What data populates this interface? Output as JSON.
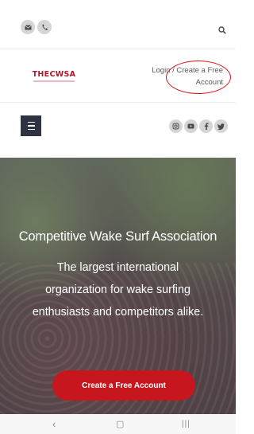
{
  "header": {
    "contact_icons": [
      "envelope-icon",
      "phone-icon"
    ],
    "search_icon": "search-icon"
  },
  "brand": {
    "logo_text": "THECWSA",
    "login_line1": "Login / Create a Free",
    "login_line2": "Account"
  },
  "nav": {
    "menu_icon": "hamburger-icon",
    "social_icons": [
      "instagram-icon",
      "youtube-icon",
      "facebook-icon",
      "twitter-icon"
    ]
  },
  "hero": {
    "title": "Competitive Wake Surf Association",
    "subtitle_lines": [
      "The largest international",
      "organization for wake surfing",
      "enthusiasts and competitors alike."
    ],
    "cta_label": "Create a Free Account"
  },
  "system_nav": {
    "back": "‹",
    "home": "▢",
    "recents": "|||"
  },
  "colors": {
    "accent_red": "#c8161f",
    "navy": "#2d3342",
    "annotation": "#d8151c"
  }
}
